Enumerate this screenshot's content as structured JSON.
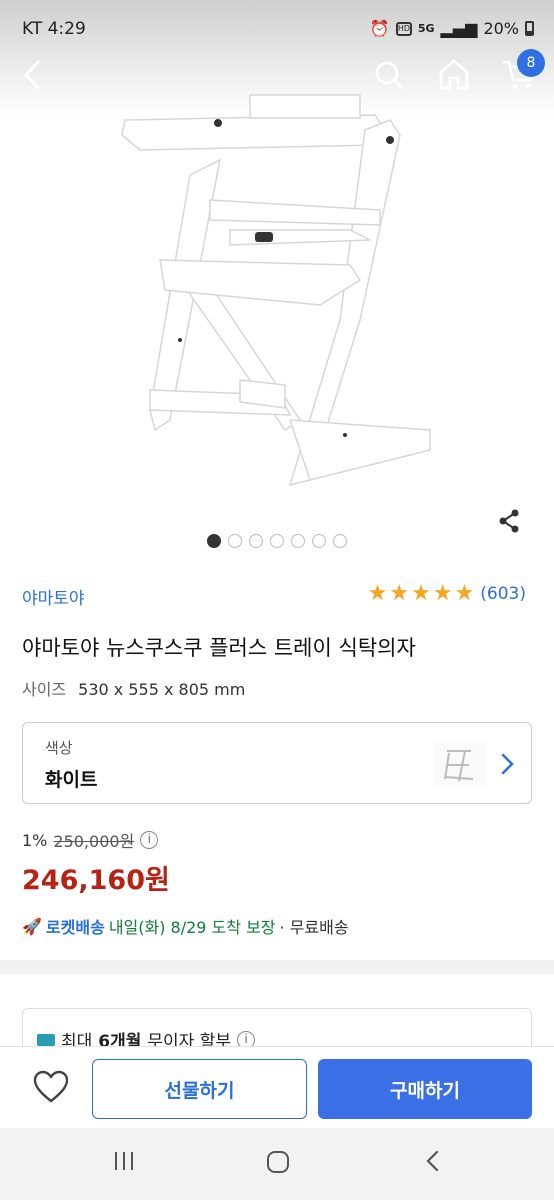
{
  "status_bar": {
    "carrier_time": "KT 4:29",
    "hd_label": "HD",
    "network": "5G",
    "battery": "20%"
  },
  "header": {
    "cart_count": "8"
  },
  "gallery": {
    "image_count": 7,
    "active_index": 0
  },
  "product": {
    "brand": "야마토야",
    "rating_stars": 5,
    "rating_count": "(603)",
    "title": "야마토야 뉴스쿠스쿠 플러스 트레이 식탁의자",
    "size_label": "사이즈",
    "size_value": "530 x 555 x 805 mm"
  },
  "option": {
    "label": "색상",
    "value": "화이트"
  },
  "pricing": {
    "discount": "1%",
    "original_price": "250,000원",
    "sale_price": "246,160원"
  },
  "delivery": {
    "rocket": "로켓배송",
    "date": "내일(화) 8/29 도착 보장",
    "free": "· 무료배송"
  },
  "promo": {
    "prefix": "최대",
    "months": "6개월",
    "suffix": "무이자 할부"
  },
  "actions": {
    "gift_label": "선물하기",
    "buy_label": "구매하기"
  },
  "colors": {
    "accent_blue": "#2a6fd8",
    "price_red": "#b42314",
    "delivery_green": "#127a3b",
    "star": "#f5a623"
  }
}
